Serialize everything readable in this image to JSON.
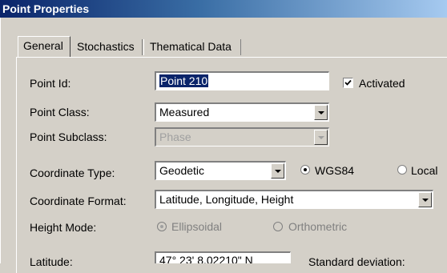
{
  "window": {
    "title": "Point Properties"
  },
  "tabs": [
    {
      "label": "General",
      "active": true
    },
    {
      "label": "Stochastics",
      "active": false
    },
    {
      "label": "Thematical Data",
      "active": false
    }
  ],
  "form": {
    "point_id": {
      "label": "Point Id:",
      "value": "Point 210"
    },
    "activated": {
      "label": "Activated",
      "checked": true
    },
    "point_class": {
      "label": "Point Class:",
      "value": "Measured"
    },
    "point_subclass": {
      "label": "Point Subclass:",
      "value": "Phase",
      "disabled": true
    },
    "coordinate_type": {
      "label": "Coordinate Type:",
      "value": "Geodetic"
    },
    "coord_system": {
      "wgs84": "WGS84",
      "local": "Local",
      "selected": "WGS84"
    },
    "coordinate_format": {
      "label": "Coordinate Format:",
      "value": "Latitude, Longitude, Height"
    },
    "height_mode": {
      "label": "Height Mode:",
      "ellipsoidal": "Ellipsoidal",
      "orthometric": "Orthometric",
      "selected": "Ellipsoidal",
      "disabled": true
    },
    "latitude": {
      "label": "Latitude:",
      "value": "47° 23'   8.02210\" N"
    },
    "standard_deviation": {
      "label": "Standard deviation:"
    }
  },
  "colors": {
    "title_start": "#0a246a",
    "title_end": "#a6caf0",
    "face": "#d4d0c8",
    "selection": "#0a246a"
  }
}
